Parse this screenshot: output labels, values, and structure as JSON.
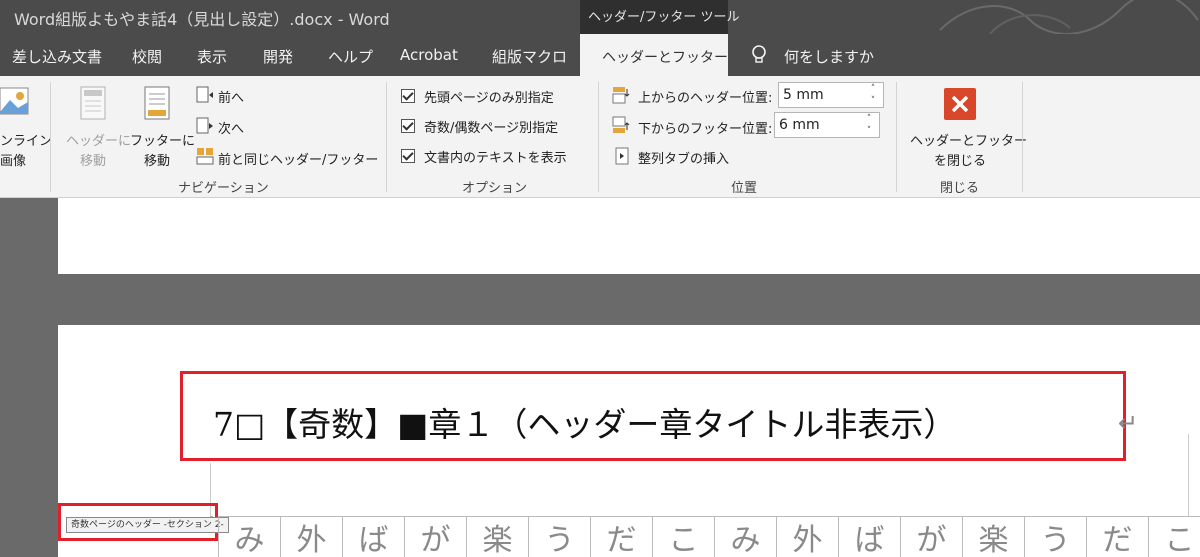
{
  "window": {
    "title": "Word組版よもやま話4（見出し設定）.docx  -  Word",
    "context_tools": "ヘッダー/フッター ツール"
  },
  "tabs": {
    "items": [
      "差し込み文書",
      "校閲",
      "表示",
      "開発",
      "ヘルプ",
      "Acrobat",
      "組版マクロ"
    ],
    "active": "ヘッダーとフッター",
    "tell_me": "何をしますか"
  },
  "ribbon": {
    "insert": {
      "online_picture_top": "ンライン",
      "online_picture_bottom": "画像"
    },
    "navigation": {
      "goto_header_top": "ヘッダーに",
      "goto_header_bottom": "移動",
      "goto_footer_top": "フッターに",
      "goto_footer_bottom": "移動",
      "previous": "前へ",
      "next": "次へ",
      "link_to_previous": "前と同じヘッダー/フッター",
      "group_label": "ナビゲーション"
    },
    "options": {
      "different_first_page": "先頭ページのみ別指定",
      "different_odd_even": "奇数/偶数ページ別指定",
      "show_document_text": "文書内のテキストを表示",
      "group_label": "オプション"
    },
    "position": {
      "header_from_top_label": "上からのヘッダー位置:",
      "header_from_top_value": "5 mm",
      "footer_from_bottom_label": "下からのフッター位置:",
      "footer_from_bottom_value": "6 mm",
      "insert_alignment_tab": "整列タブの挿入",
      "group_label": "位置"
    },
    "close": {
      "close_top": "ヘッダーとフッター",
      "close_bottom": "を閉じる",
      "group_label": "閉じる"
    }
  },
  "document": {
    "header_text": "7□【奇数】■章１（ヘッダー章タイトル非表示）",
    "paragraph_mark": "↵",
    "header_tag": "奇数ページのヘッダー -セクション 2-",
    "grid_chars": [
      "み",
      "外",
      "ば",
      "が",
      "楽",
      "う",
      "だ",
      "こ",
      "み",
      "外",
      "ば",
      "が",
      "楽",
      "う",
      "だ",
      "こ"
    ]
  },
  "colors": {
    "titlebar": "#4b4b4b",
    "ribbon": "#f3f3f3",
    "highlight_red": "#e0202a",
    "close_button": "#d9472b"
  }
}
